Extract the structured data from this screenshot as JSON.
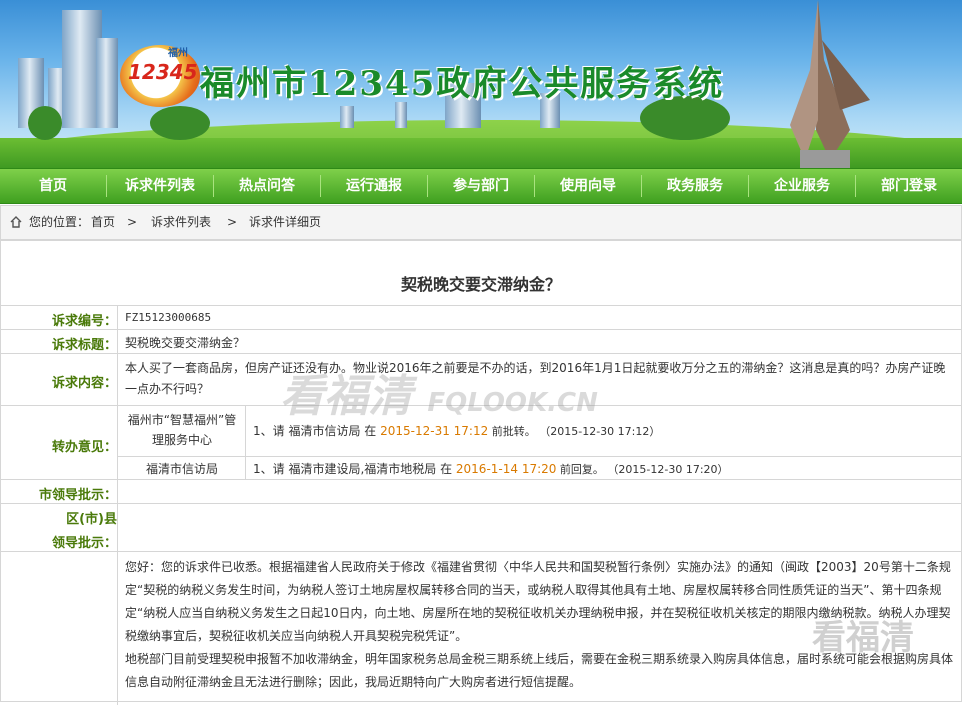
{
  "header": {
    "logo_text": "12345",
    "logo_city": "福州",
    "site_title": "福州市12345政府公共服务系统"
  },
  "nav": {
    "items": [
      {
        "label": "首页"
      },
      {
        "label": "诉求件列表"
      },
      {
        "label": "热点问答"
      },
      {
        "label": "运行通报"
      },
      {
        "label": "参与部门"
      },
      {
        "label": "使用向导"
      },
      {
        "label": "政务服务"
      },
      {
        "label": "企业服务"
      },
      {
        "label": "部门登录"
      }
    ]
  },
  "breadcrumb": {
    "prefix": "您的位置：",
    "items": [
      "首页",
      "诉求件列表",
      "诉求件详细页"
    ],
    "separator": ">"
  },
  "detail": {
    "title": "契税晚交要交滞纳金？",
    "id_label": "诉求编号：",
    "id_value": "FZ15123000685",
    "subject_label": "诉求标题：",
    "subject_value": "契税晚交要交滞纳金？",
    "content_label": "诉求内容：",
    "content_value": "本人买了一套商品房，但房产证还没有办。物业说2016年之前要是不办的话，到2016年1月1日起就要收万分之五的滞纳金？这消息是真的吗？办房产证晚一点办不行吗？",
    "transfer_label": "转办意见：",
    "transfers": [
      {
        "org": "福州市“智慧福州”管理服务中心",
        "prefix": "1、请  福清市信访局  在 ",
        "deadline": "2015-12-31 17:12",
        "suffix": "  前批转。 （2015-12-30 17:12）"
      },
      {
        "org": "福清市信访局",
        "prefix": "1、请  福清市建设局,福清市地税局  在 ",
        "deadline": "2016-1-14 17:20",
        "suffix": "  前回复。 （2015-12-30 17:20）"
      }
    ],
    "city_leader_label": "市领导批示：",
    "district_leader_label_1": "区(市)县",
    "district_leader_label_2": "领导批示：",
    "reply_p1": "您好：您的诉求件已收悉。根据福建省人民政府关于修改《福建省贯彻〈中华人民共和国契税暂行条例〉实施办法》的通知（闽政【2003】20号第十二条规定“契税的纳税义务发生时间，为纳税人签订土地房屋权属转移合同的当天，或纳税人取得其他具有土地、房屋权属转移合同性质凭证的当天”、第十四条规定“纳税人应当自纳税义务发生之日起10日内，向土地、房屋所在地的契税征收机关办理纳税申报，并在契税征收机关核定的期限内缴纳税款。纳税人办理契税缴纳事宜后，契税征收机关应当向纳税人开具契税完税凭证”。",
    "reply_p2": "地税部门目前受理契税申报暂不加收滞纳金，明年国家税务总局金税三期系统上线后，需要在金税三期系统录入购房具体信息，届时系统可能会根据购房具体信息自动附征滞纳金且无法进行删除；因此，我局近期特向广大购房者进行短信提醒。"
  },
  "watermark": {
    "text_cn": "看福清",
    "text_en": "FQLOOK.CN"
  },
  "colors": {
    "nav_green": "#3fa020",
    "label_green": "#4a7a0a",
    "deadline_orange": "#d97a00",
    "title_green": "#1a8a2a"
  }
}
